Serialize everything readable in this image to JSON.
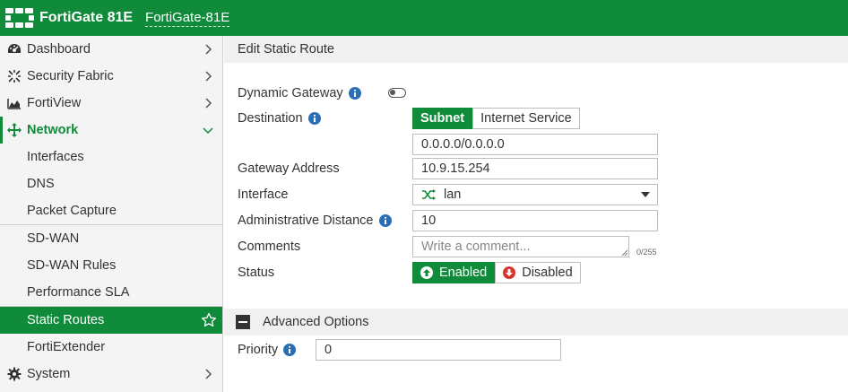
{
  "header": {
    "brand": "FortiGate 81E",
    "hostname": "FortiGate-81E"
  },
  "sidebar": {
    "items": [
      {
        "label": "Dashboard",
        "icon": "dashboard-icon"
      },
      {
        "label": "Security Fabric",
        "icon": "security-fabric-icon"
      },
      {
        "label": "FortiView",
        "icon": "fortiview-icon"
      },
      {
        "label": "Network",
        "icon": "network-icon"
      },
      {
        "label": "Interfaces"
      },
      {
        "label": "DNS"
      },
      {
        "label": "Packet Capture"
      },
      {
        "label": "SD-WAN"
      },
      {
        "label": "SD-WAN Rules"
      },
      {
        "label": "Performance SLA"
      },
      {
        "label": "Static Routes"
      },
      {
        "label": "FortiExtender"
      },
      {
        "label": "System",
        "icon": "gear-icon"
      }
    ]
  },
  "form": {
    "title": "Edit Static Route",
    "dynamic_gateway_label": "Dynamic Gateway",
    "destination_label": "Destination",
    "destination_options": [
      "Subnet",
      "Internet Service"
    ],
    "destination_value": "0.0.0.0/0.0.0.0",
    "gateway_label": "Gateway Address",
    "gateway_value": "10.9.15.254",
    "interface_label": "Interface",
    "interface_value": "lan",
    "distance_label": "Administrative Distance",
    "distance_value": "10",
    "comments_label": "Comments",
    "comments_placeholder": "Write a comment...",
    "comments_counter": "0/255",
    "status_label": "Status",
    "status_options": [
      "Enabled",
      "Disabled"
    ],
    "advanced_label": "Advanced Options",
    "priority_label": "Priority",
    "priority_value": "0"
  },
  "colors": {
    "brand_green": "#0f8b3a",
    "info_blue": "#2a6fb5",
    "disabled_red": "#d9342b"
  }
}
